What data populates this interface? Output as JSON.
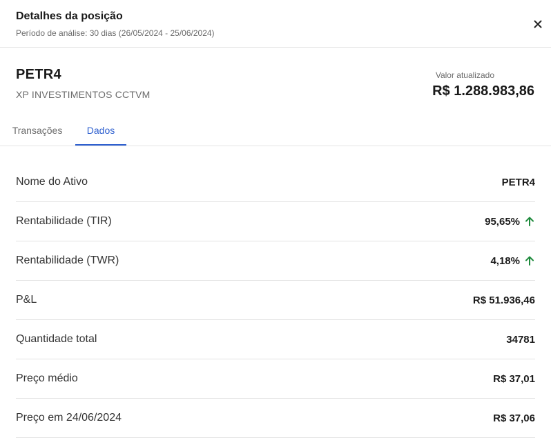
{
  "header": {
    "title": "Detalhes da posição",
    "subtitle": "Período de análise: 30 dias (26/05/2024 - 25/06/2024)",
    "close_icon": "close-icon"
  },
  "asset": {
    "ticker": "PETR4",
    "broker": "XP INVESTIMENTOS CCTVM",
    "value_label": "Valor atualizado",
    "value": "R$ 1.288.983,86"
  },
  "tabs": [
    {
      "label": "Transações",
      "active": false
    },
    {
      "label": "Dados",
      "active": true
    }
  ],
  "colors": {
    "accent": "#2d5fcf",
    "positive": "#1e8a3c",
    "divider": "#e3e3e3"
  },
  "rows": [
    {
      "label": "Nome do Ativo",
      "value": "PETR4"
    },
    {
      "label": "Rentabilidade (TIR)",
      "value": "95,65%",
      "trend_icon": "arrow-up-icon"
    },
    {
      "label": "Rentabilidade (TWR)",
      "value": "4,18%",
      "trend_icon": "arrow-up-icon"
    },
    {
      "label": "P&L",
      "value": "R$ 51.936,46"
    },
    {
      "label": "Quantidade total",
      "value": "34781"
    },
    {
      "label": "Preço médio",
      "value": "R$ 37,01"
    },
    {
      "label": "Preço em 24/06/2024",
      "value": "R$ 37,06"
    }
  ]
}
